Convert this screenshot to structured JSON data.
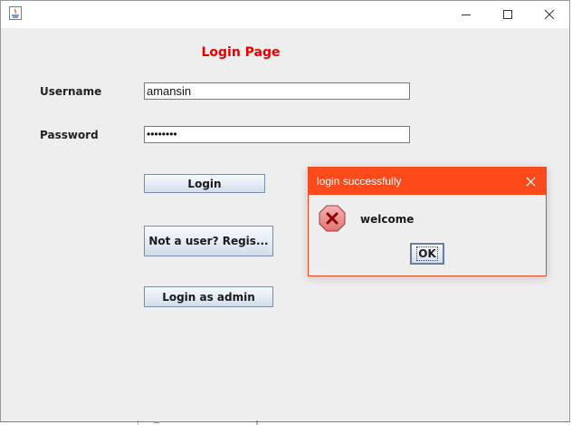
{
  "window": {
    "app_icon": "java-icon",
    "controls": {
      "minimize": "minimize-icon",
      "maximize": "maximize-icon",
      "close": "close-icon"
    }
  },
  "form": {
    "title": "Login Page",
    "username_label": "Username",
    "username_value": "amansin",
    "password_label": "Password",
    "password_value": "••••••••",
    "login_button": "Login",
    "register_button": "Not a user? Regis...",
    "admin_button": "Login as admin"
  },
  "dialog": {
    "title": "login successfully",
    "message": "welcome",
    "ok_button": "OK",
    "icon": "error-icon"
  },
  "colors": {
    "title_red": "#e60000",
    "dialog_titlebar": "#fc4a1a",
    "background": "#eeeeee"
  }
}
